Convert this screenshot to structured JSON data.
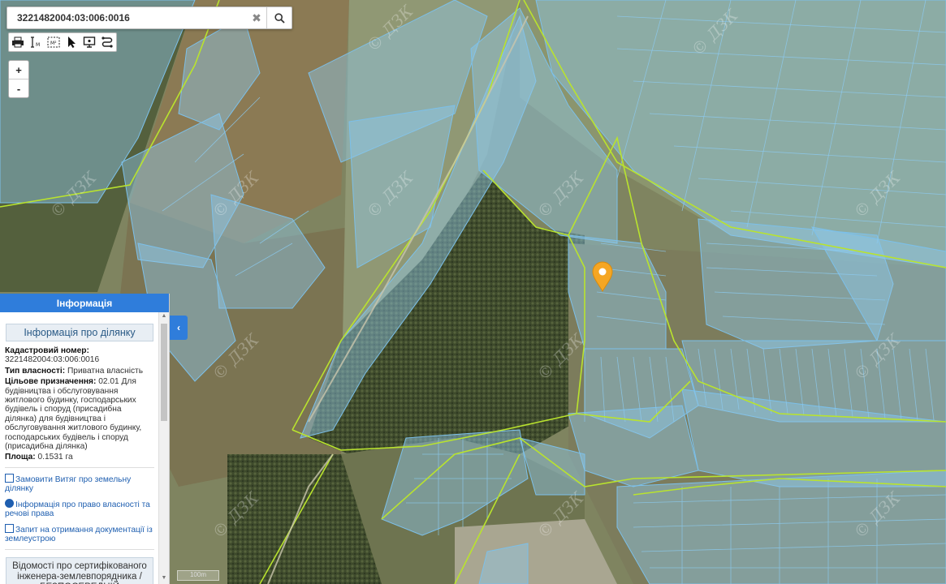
{
  "search": {
    "value": "3221482004:03:006:0016",
    "clear_icon": "close-icon",
    "search_icon": "search-icon"
  },
  "toolbar": {
    "icons": [
      "print-icon",
      "measure-distance-icon",
      "measure-area-icon",
      "pointer-icon",
      "screen-icon",
      "layers-path-icon"
    ],
    "measure_m": "M",
    "measure_m2": "M²"
  },
  "zoom": {
    "in": "+",
    "out": "-"
  },
  "map": {
    "watermark": "© ДЗК",
    "scale_label": "100m",
    "accent": "#f5a623",
    "parcel_color": "#8fc8e8",
    "boundary_color": "#b7e22c"
  },
  "panel": {
    "header": "Інформація",
    "section_title": "Інформація про ділянку",
    "cadastral_label": "Кадастровий номер:",
    "cadastral_value": "3221482004:03:006:0016",
    "ownership_label": "Тип власності:",
    "ownership_value": "Приватна власність",
    "purpose_label": "Цільове призначення:",
    "purpose_value": "02.01 Для будівництва і обслуговування житлового будинку, господарських будівель і споруд (присадибна ділянка) для будівництва і обслуговування житлового будинку, господарських будівель і споруд (присадибна ділянка)",
    "area_label": "Площа:",
    "area_value": "0.1531 га",
    "links": [
      {
        "icon": "document-icon",
        "label": "Замовити Витяг про земельну ділянку"
      },
      {
        "icon": "info-icon",
        "label": "Інформація про право власності та речові права"
      },
      {
        "icon": "document-icon",
        "label": "Запит на отримання документації із землеустрою"
      }
    ],
    "cert_title": "Відомості про сертифікованого інженера-землевпорядника / БЕЗПОСЕРЕДНІЙ ВИКОНАВЕЦЬ"
  }
}
